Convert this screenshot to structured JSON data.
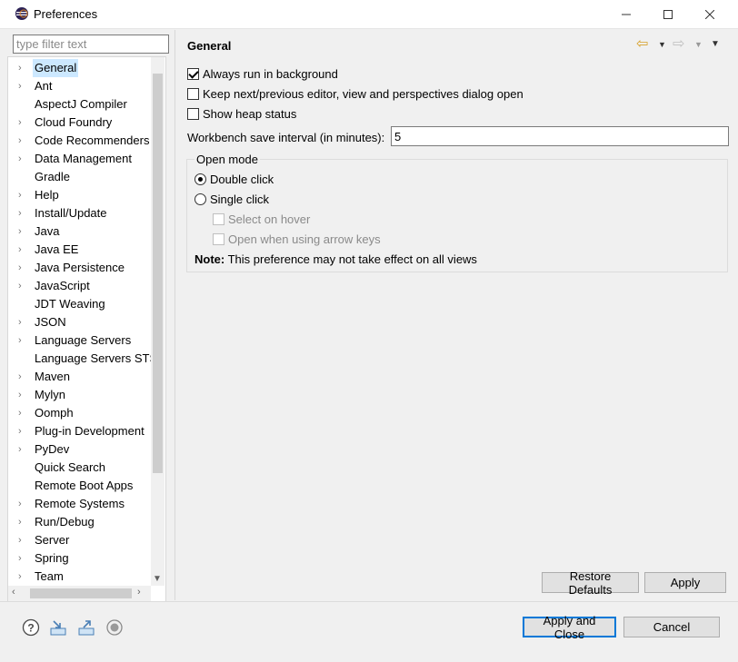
{
  "window": {
    "title": "Preferences"
  },
  "filter": {
    "placeholder": "type filter text"
  },
  "tree": [
    {
      "label": "General",
      "expandable": true,
      "selected": true
    },
    {
      "label": "Ant",
      "expandable": true
    },
    {
      "label": "AspectJ Compiler",
      "expandable": false
    },
    {
      "label": "Cloud Foundry",
      "expandable": true
    },
    {
      "label": "Code Recommenders",
      "expandable": true
    },
    {
      "label": "Data Management",
      "expandable": true
    },
    {
      "label": "Gradle",
      "expandable": false
    },
    {
      "label": "Help",
      "expandable": true
    },
    {
      "label": "Install/Update",
      "expandable": true
    },
    {
      "label": "Java",
      "expandable": true
    },
    {
      "label": "Java EE",
      "expandable": true
    },
    {
      "label": "Java Persistence",
      "expandable": true
    },
    {
      "label": "JavaScript",
      "expandable": true
    },
    {
      "label": "JDT Weaving",
      "expandable": false
    },
    {
      "label": "JSON",
      "expandable": true
    },
    {
      "label": "Language Servers",
      "expandable": true
    },
    {
      "label": "Language Servers STS",
      "expandable": false
    },
    {
      "label": "Maven",
      "expandable": true
    },
    {
      "label": "Mylyn",
      "expandable": true
    },
    {
      "label": "Oomph",
      "expandable": true
    },
    {
      "label": "Plug-in Development",
      "expandable": true
    },
    {
      "label": "PyDev",
      "expandable": true
    },
    {
      "label": "Quick Search",
      "expandable": false
    },
    {
      "label": "Remote Boot Apps",
      "expandable": false
    },
    {
      "label": "Remote Systems",
      "expandable": true
    },
    {
      "label": "Run/Debug",
      "expandable": true
    },
    {
      "label": "Server",
      "expandable": true
    },
    {
      "label": "Spring",
      "expandable": true
    },
    {
      "label": "Team",
      "expandable": true
    }
  ],
  "page": {
    "title": "General",
    "options": {
      "always_run_background": {
        "label": "Always run in background",
        "checked": true
      },
      "keep_dialog_open": {
        "label": "Keep next/previous editor, view and perspectives dialog open",
        "checked": false
      },
      "show_heap": {
        "label": "Show heap status",
        "checked": false
      }
    },
    "save_interval": {
      "label": "Workbench save interval (in minutes):",
      "value": "5"
    },
    "open_mode": {
      "title": "Open mode",
      "double_click": {
        "label": "Double click",
        "selected": true
      },
      "single_click": {
        "label": "Single click",
        "selected": false
      },
      "select_on_hover": {
        "label": "Select on hover",
        "checked": false
      },
      "open_arrow_keys": {
        "label": "Open when using arrow keys",
        "checked": false
      }
    },
    "note": {
      "prefix": "Note:",
      "text": " This preference may not take effect on all views"
    },
    "restore_defaults": "Restore Defaults",
    "apply": "Apply"
  },
  "footer": {
    "apply_and_close": "Apply and Close",
    "cancel": "Cancel"
  },
  "colors": {
    "selection": "#cce8ff",
    "default_button_border": "#0078d7",
    "back_arrow": "#d8a22c"
  }
}
